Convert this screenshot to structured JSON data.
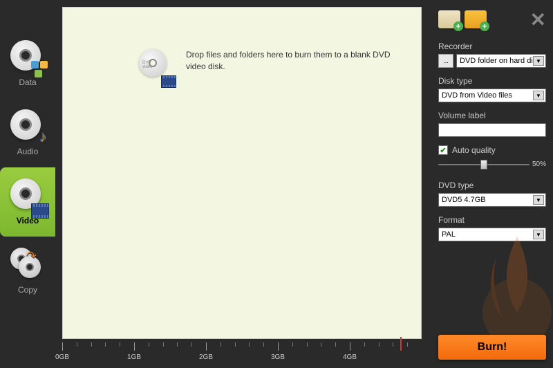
{
  "sidebar": {
    "items": [
      {
        "label": "Data"
      },
      {
        "label": "Audio"
      },
      {
        "label": "Video"
      },
      {
        "label": "Copy"
      }
    ],
    "active_index": 2
  },
  "drop": {
    "text": "Drop files and folders here to burn them to a blank DVD video disk.",
    "disc_label": "DVD\nvideo"
  },
  "ruler": {
    "ticks": [
      "0GB",
      "1GB",
      "2GB",
      "3GB",
      "4GB"
    ],
    "limit_gb": 4.7,
    "max_gb": 5.0
  },
  "panel": {
    "recorder": {
      "label": "Recorder",
      "value": "DVD folder on hard disk",
      "browse": "..."
    },
    "disk_type": {
      "label": "Disk type",
      "value": "DVD from Video files"
    },
    "volume": {
      "label": "Volume label",
      "value": ""
    },
    "auto_quality": {
      "label": "Auto quality",
      "checked": true
    },
    "quality": {
      "percent": "50%",
      "value": 50
    },
    "dvd_type": {
      "label": "DVD type",
      "value": "DVD5 4.7GB"
    },
    "format": {
      "label": "Format",
      "value": "PAL"
    }
  },
  "burn_label": "Burn!",
  "icons": {
    "add_file": "add-file",
    "add_folder": "add-folder",
    "close": "✕"
  }
}
